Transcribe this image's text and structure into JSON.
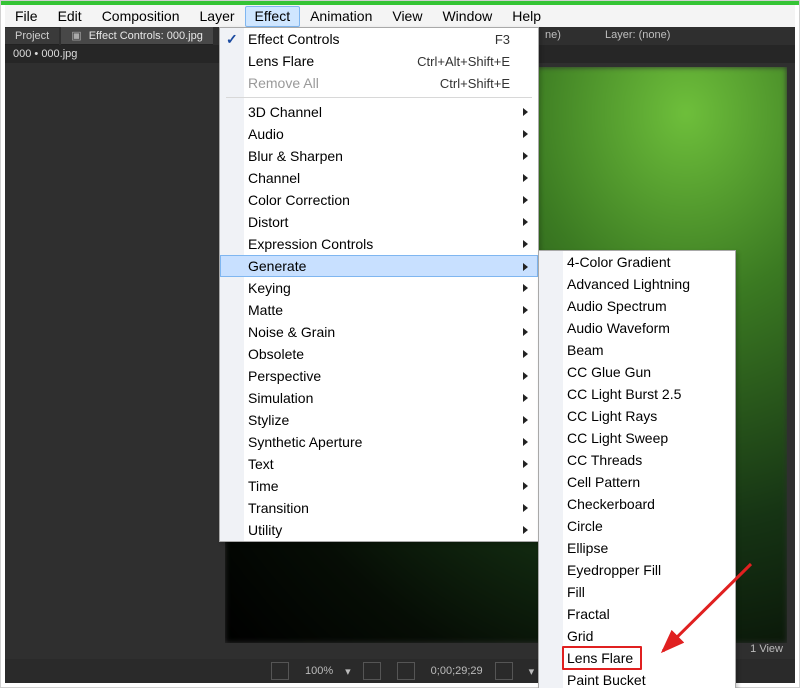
{
  "menubar": {
    "items": [
      "File",
      "Edit",
      "Composition",
      "Layer",
      "Effect",
      "Animation",
      "View",
      "Window",
      "Help"
    ],
    "open_index": 4
  },
  "workspace": {
    "tabs": [
      {
        "label": "Project"
      },
      {
        "label": "Effect Controls: 000.jpg"
      }
    ],
    "layer_label": "Layer: (none)",
    "layer_partial": "ne)",
    "project_line": "000 • 000.jpg"
  },
  "effect_menu": {
    "items": [
      {
        "label": "Effect Controls",
        "checked": true,
        "shortcut": "F3"
      },
      {
        "label": "Lens Flare",
        "shortcut": "Ctrl+Alt+Shift+E"
      },
      {
        "label": "Remove All",
        "disabled": true,
        "shortcut": "Ctrl+Shift+E"
      }
    ],
    "categories": [
      "3D Channel",
      "Audio",
      "Blur & Sharpen",
      "Channel",
      "Color Correction",
      "Distort",
      "Expression Controls",
      "Generate",
      "Keying",
      "Matte",
      "Noise & Grain",
      "Obsolete",
      "Perspective",
      "Simulation",
      "Stylize",
      "Synthetic Aperture",
      "Text",
      "Time",
      "Transition",
      "Utility"
    ],
    "hover_index": 7
  },
  "generate_submenu": {
    "items": [
      "4-Color Gradient",
      "Advanced Lightning",
      "Audio Spectrum",
      "Audio Waveform",
      "Beam",
      "CC Glue Gun",
      "CC Light Burst 2.5",
      "CC Light Rays",
      "CC Light Sweep",
      "CC Threads",
      "Cell Pattern",
      "Checkerboard",
      "Circle",
      "Ellipse",
      "Eyedropper Fill",
      "Fill",
      "Fractal",
      "Grid",
      "Lens Flare",
      "Paint Bucket"
    ],
    "highlight_index": 18
  },
  "statusbar": {
    "zoom": "100%",
    "timecode": "0;00;29;29",
    "view_label": "1 View"
  }
}
